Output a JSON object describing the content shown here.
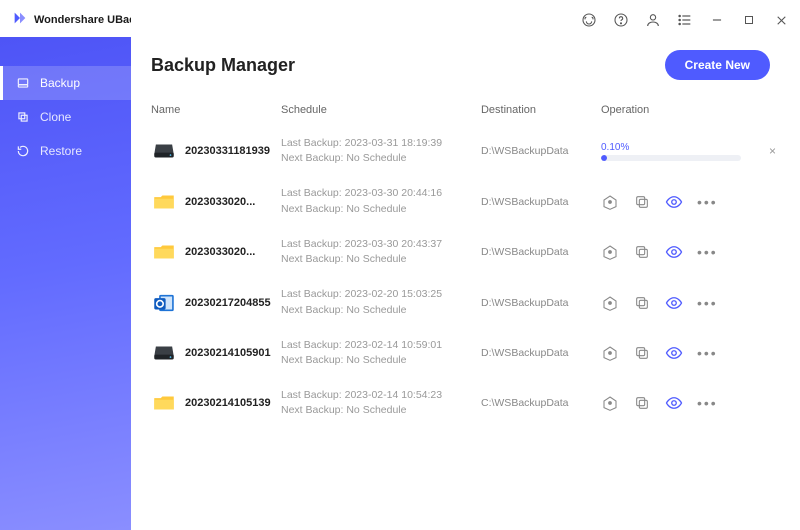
{
  "brand": {
    "name": "Wondershare UBackit"
  },
  "sidebar": {
    "items": [
      {
        "label": "Backup"
      },
      {
        "label": "Clone"
      },
      {
        "label": "Restore"
      }
    ]
  },
  "header": {
    "title": "Backup Manager",
    "create_label": "Create New"
  },
  "columns": {
    "name": "Name",
    "schedule": "Schedule",
    "destination": "Destination",
    "operation": "Operation"
  },
  "rows": [
    {
      "icon": "disk",
      "name": "20230331181939",
      "last": "Last Backup: 2023-03-31 18:19:39",
      "next": "Next Backup: No Schedule",
      "dest": "D:\\WSBackupData",
      "progress": {
        "label": "0.10%",
        "pct": 0.1
      }
    },
    {
      "icon": "folder",
      "name": "2023033020...",
      "last": "Last Backup: 2023-03-30 20:44:16",
      "next": "Next Backup: No Schedule",
      "dest": "D:\\WSBackupData"
    },
    {
      "icon": "folder",
      "name": "2023033020...",
      "last": "Last Backup: 2023-03-30 20:43:37",
      "next": "Next Backup: No Schedule",
      "dest": "D:\\WSBackupData"
    },
    {
      "icon": "outlook",
      "name": "20230217204855",
      "last": "Last Backup: 2023-02-20 15:03:25",
      "next": "Next Backup: No Schedule",
      "dest": "D:\\WSBackupData"
    },
    {
      "icon": "disk",
      "name": "20230214105901",
      "last": "Last Backup: 2023-02-14 10:59:01",
      "next": "Next Backup: No Schedule",
      "dest": "D:\\WSBackupData"
    },
    {
      "icon": "folder",
      "name": "20230214105139",
      "last": "Last Backup: 2023-02-14 10:54:23",
      "next": "Next Backup: No Schedule",
      "dest": "C:\\WSBackupData"
    }
  ]
}
